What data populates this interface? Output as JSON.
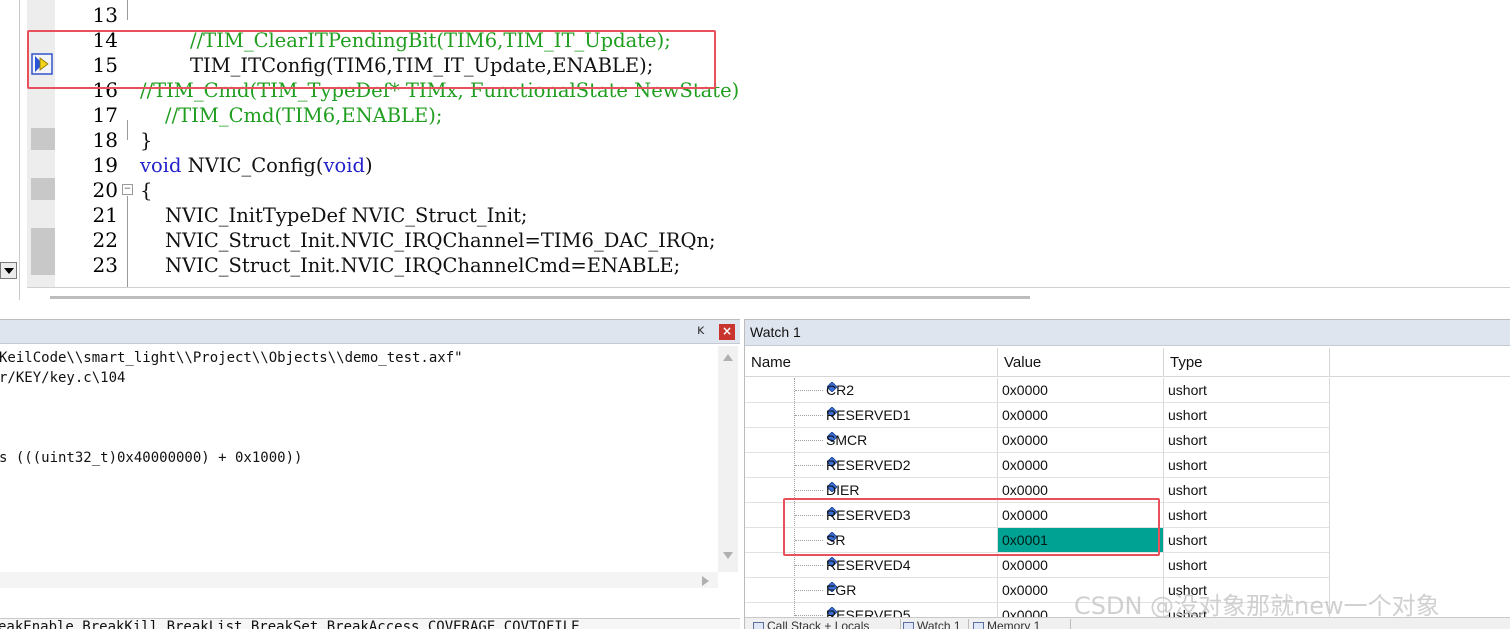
{
  "editor": {
    "line_numbers": [
      "13",
      "14",
      "15",
      "16",
      "17",
      "18",
      "19",
      "20",
      "21",
      "22",
      "23"
    ],
    "code_lines": {
      "l14": "//TIM_ClearITPendingBit(TIM6,TIM_IT_Update);",
      "l15": "TIM_ITConfig(TIM6,TIM_IT_Update,ENABLE);",
      "l16": "//TIM_Cmd(TIM_TypeDef* TIMx, FunctionalState NewState)",
      "l17": "//TIM_Cmd(TIM6,ENABLE);",
      "l18": "}",
      "l19_kw": "void",
      "l19_mid": " NVIC_Config(",
      "l19_kw2": "void",
      "l19_end": ")",
      "l20": "{",
      "l21": "NVIC_InitTypeDef NVIC_Struct_Init;",
      "l22": "NVIC_Struct_Init.NVIC_IRQChannel=TIM6_DAC_IRQn;",
      "l23": "NVIC_Struct_Init.NVIC_IRQChannelCmd=ENABLE;"
    },
    "colors": {
      "comment": "#1f9e1f",
      "keyword": "#2222cc",
      "highlight_box": "#e8505b"
    }
  },
  "command_window": {
    "pin_glyph": "ᵘ",
    "close_glyph": "×",
    "lines": [
      "KeilCode\\\\smart_light\\\\Project\\\\Objects\\\\demo_test.axf\"",
      "r/KEY/key.c\\104",
      "s (((uint32_t)0x40000000) + 0x1000))"
    ],
    "bottom_line": "eakEnable BreakKill BreakList BreakSet BreakAccess COVERAGE COVTOFILE"
  },
  "watch": {
    "title": "Watch 1",
    "headers": {
      "name": "Name",
      "value": "Value",
      "type": "Type"
    },
    "rows": [
      {
        "name": "CR2",
        "value": "0x0000",
        "type": "ushort"
      },
      {
        "name": "RESERVED1",
        "value": "0x0000",
        "type": "ushort"
      },
      {
        "name": "SMCR",
        "value": "0x0000",
        "type": "ushort"
      },
      {
        "name": "RESERVED2",
        "value": "0x0000",
        "type": "ushort"
      },
      {
        "name": "DIER",
        "value": "0x0000",
        "type": "ushort"
      },
      {
        "name": "RESERVED3",
        "value": "0x0000",
        "type": "ushort"
      },
      {
        "name": "SR",
        "value": "0x0001",
        "type": "ushort"
      },
      {
        "name": "RESERVED4",
        "value": "0x0000",
        "type": "ushort"
      },
      {
        "name": "EGR",
        "value": "0x0000",
        "type": "ushort"
      },
      {
        "name": "RESERVED5",
        "value": "0x0000",
        "type": "ushort"
      }
    ],
    "changed_value_color": "#00a393",
    "tabs": [
      "Call Stack + Locals",
      "Watch 1",
      "Memory 1"
    ]
  },
  "watermark": "CSDN @没对象那就new一个对象"
}
